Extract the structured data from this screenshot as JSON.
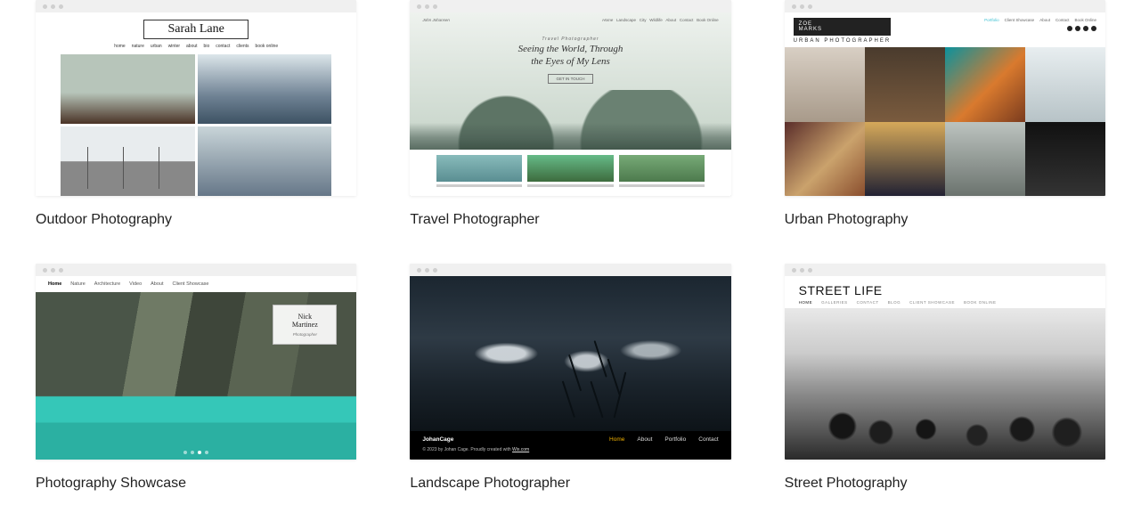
{
  "templates": [
    {
      "title": "Outdoor Photography",
      "preview": {
        "logo": "Sarah Lane",
        "nav": [
          "home",
          "nature",
          "urban",
          "winter",
          "about",
          "bio",
          "contact",
          "clients",
          "book online"
        ]
      }
    },
    {
      "title": "Travel Photographer",
      "preview": {
        "site_name": "John Johansen",
        "top_nav": [
          "Home",
          "Landscape",
          "City",
          "Wildlife",
          "About",
          "Contact",
          "Book Online"
        ],
        "pretitle": "Travel Photographer",
        "headline_l1": "Seeing the World, Through",
        "headline_l2": "the Eyes of My Lens",
        "cta": "GET IN TOUCH"
      }
    },
    {
      "title": "Urban Photography",
      "preview": {
        "brand_l1": "ZOE",
        "brand_l2": "MARKS",
        "subtitle": "URBAN PHOTOGRAPHER",
        "nav": [
          "Portfolio",
          "Client Showcase",
          "About",
          "Contact",
          "Book Online"
        ]
      }
    },
    {
      "title": "Photography Showcase",
      "preview": {
        "nav": [
          "Home",
          "Nature",
          "Architecture",
          "Video",
          "About",
          "Client Showcase"
        ],
        "name_l1": "Nick",
        "name_l2": "Martinez",
        "role": "Photographer"
      }
    },
    {
      "title": "Landscape Photographer",
      "preview": {
        "brand": "JohanCage",
        "nav": [
          "Home",
          "About",
          "Portfolio",
          "Contact"
        ],
        "copyright": "© 2023 by Johan Cage. Proudly created with ",
        "copyright_link": "Wix.com"
      }
    },
    {
      "title": "Street Photography",
      "preview": {
        "brand": "STREET LIFE",
        "nav": [
          "HOME",
          "GALLERIES",
          "CONTACT",
          "BLOG",
          "CLIENT SHOWCASE",
          "BOOK ONLINE"
        ]
      }
    }
  ]
}
